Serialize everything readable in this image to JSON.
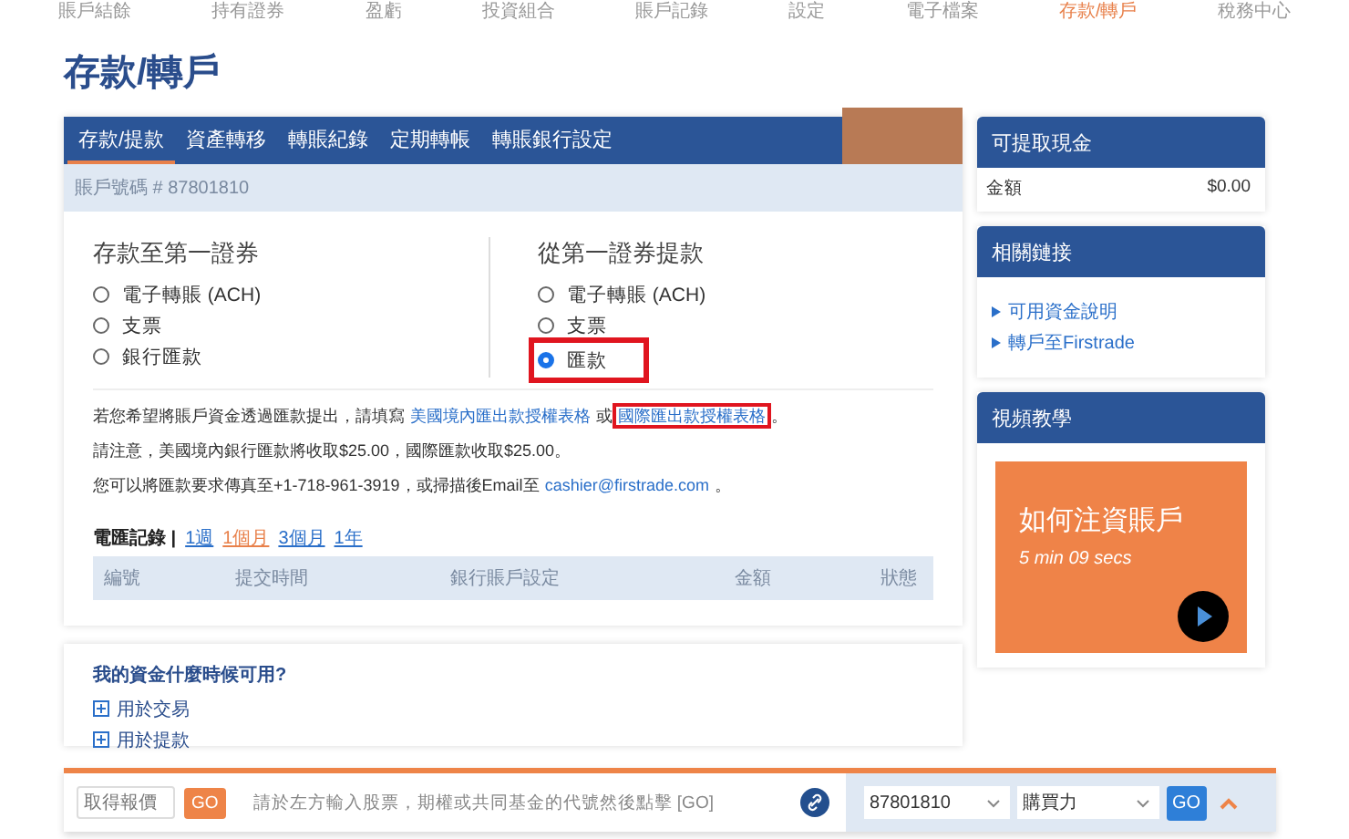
{
  "top_nav": [
    {
      "label": "賬戶結餘",
      "selected": false
    },
    {
      "label": "持有證券",
      "selected": false
    },
    {
      "label": "盈虧",
      "selected": false
    },
    {
      "label": "投資組合",
      "selected": false
    },
    {
      "label": "賬戶記錄",
      "selected": false
    },
    {
      "label": "設定",
      "selected": false
    },
    {
      "label": "電子檔案",
      "selected": false
    },
    {
      "label": "存款/轉戶",
      "selected": true
    },
    {
      "label": "稅務中心",
      "selected": false
    }
  ],
  "page_title": "存款/轉戶",
  "tabs": [
    {
      "label": "存款/提款",
      "selected": true
    },
    {
      "label": "資產轉移",
      "selected": false
    },
    {
      "label": "轉賬紀錄",
      "selected": false
    },
    {
      "label": "定期轉帳",
      "selected": false
    },
    {
      "label": "轉賬銀行設定",
      "selected": false
    }
  ],
  "account_label": "賬戶號碼 # 87801810",
  "deposit": {
    "title": "存款至第一證券",
    "options": [
      {
        "label": "電子轉賬 (ACH)",
        "selected": false,
        "highlighted": false
      },
      {
        "label": "支票",
        "selected": false,
        "highlighted": false
      },
      {
        "label": "銀行匯款",
        "selected": false,
        "highlighted": false
      }
    ]
  },
  "withdraw": {
    "title": "從第一證券提款",
    "options": [
      {
        "label": "電子轉賬 (ACH)",
        "selected": false,
        "highlighted": false
      },
      {
        "label": "支票",
        "selected": false,
        "highlighted": false
      },
      {
        "label": "匯款",
        "selected": true,
        "highlighted": true
      }
    ]
  },
  "notes": [
    [
      {
        "kind": "text",
        "text": "若您希望將賬戶資金透過匯款提出，請填寫"
      },
      {
        "kind": "link",
        "text": "美國境內匯出款授權表格",
        "highlighted": false
      },
      {
        "kind": "text",
        "text": "或"
      },
      {
        "kind": "link",
        "text": "國際匯出款授權表格",
        "highlighted": true
      },
      {
        "kind": "text",
        "text": "。"
      }
    ],
    [
      {
        "kind": "text",
        "text": "請注意，美國境內銀行匯款將收取$25.00，國際匯款收取$25.00。"
      }
    ],
    [
      {
        "kind": "text",
        "text": "您可以將匯款要求傳真至+1-718-961-3919，或掃描後Email至"
      },
      {
        "kind": "link",
        "text": "cashier@firstrade.com",
        "highlighted": false
      },
      {
        "kind": "text",
        "text": "。"
      }
    ]
  ],
  "records": {
    "label": "電匯記錄 |",
    "periods": [
      {
        "label": "1週",
        "selected": false
      },
      {
        "label": "1個月",
        "selected": true
      },
      {
        "label": "3個月",
        "selected": false
      },
      {
        "label": "1年",
        "selected": false
      }
    ],
    "columns": [
      "編號",
      "提交時間",
      "銀行賬戶設定",
      "金額",
      "狀態"
    ]
  },
  "faq": {
    "title": "我的資金什麼時候可用?",
    "items": [
      {
        "label": "用於交易",
        "expanded": false
      },
      {
        "label": "用於提款",
        "expanded": false
      }
    ]
  },
  "cash_card": {
    "title": "可提取現金",
    "label": "金額",
    "value": "$0.00"
  },
  "links_card": {
    "title": "相關鏈接",
    "links": [
      "可用資金說明",
      "轉戶至Firstrade"
    ]
  },
  "video_card": {
    "title": "視頻教學",
    "video_title": "如何注資賬戶",
    "duration": "5 min 09 secs"
  },
  "bottom_bar": {
    "quote_placeholder": "取得報價",
    "go": "GO",
    "hint": "請於左方輸入股票，期權或共同基金的代號然後點擊 [GO]",
    "account": "87801810",
    "view": "購買力",
    "go2": "GO"
  }
}
